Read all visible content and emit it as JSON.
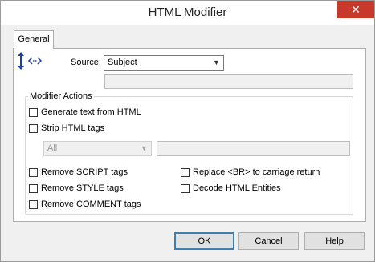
{
  "window": {
    "title": "HTML Modifier",
    "close_glyph": "✕"
  },
  "tabs": [
    {
      "label": "General"
    }
  ],
  "source": {
    "label": "Source:",
    "selected": "Subject",
    "extra_value": ""
  },
  "modifier_actions": {
    "legend": "Modifier Actions",
    "generate_text": {
      "label": "Generate text from HTML",
      "checked": false
    },
    "strip_html": {
      "label": "Strip HTML tags",
      "checked": false
    },
    "strip_scope": {
      "selected": "All",
      "value": ""
    },
    "remove_script": {
      "label": "Remove SCRIPT tags",
      "checked": false
    },
    "remove_style": {
      "label": "Remove STYLE tags",
      "checked": false
    },
    "remove_comment": {
      "label": "Remove COMMENT tags",
      "checked": false
    },
    "replace_br": {
      "label": "Replace <BR> to carriage return",
      "checked": false
    },
    "decode_entities": {
      "label": "Decode HTML Entities",
      "checked": false
    }
  },
  "buttons": {
    "ok": "OK",
    "cancel": "Cancel",
    "help": "Help"
  },
  "colors": {
    "close": "#c7392b",
    "icon": "#1a3fa8"
  }
}
